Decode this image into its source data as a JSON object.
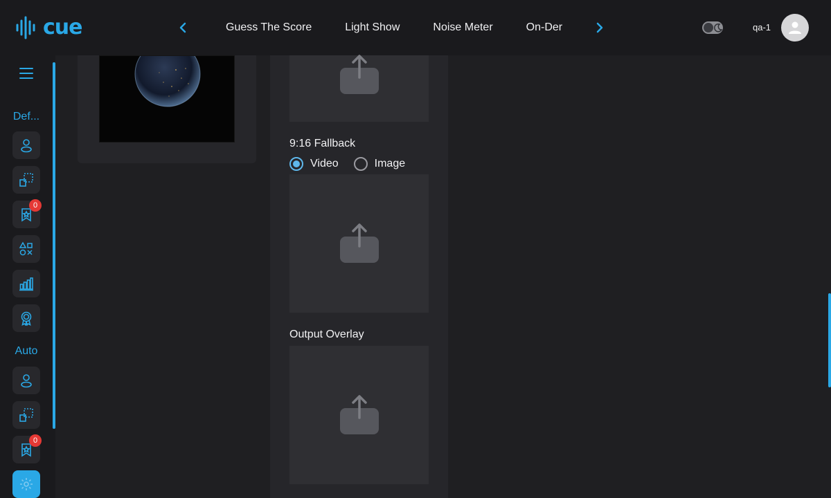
{
  "app": {
    "logo_text": "cue"
  },
  "header": {
    "tabs": [
      {
        "label": "Guess The Score"
      },
      {
        "label": "Light Show"
      },
      {
        "label": "Noise Meter"
      },
      {
        "label": "On-Der"
      }
    ],
    "username": "qa-1"
  },
  "sidebar": {
    "groups": [
      {
        "label": "Def...",
        "items": [
          {
            "icon": "person-icon"
          },
          {
            "icon": "transform-icon"
          },
          {
            "icon": "reward-icon",
            "badge": "0"
          },
          {
            "icon": "shapes-icon"
          },
          {
            "icon": "bar-chart-icon"
          },
          {
            "icon": "award-icon"
          }
        ]
      },
      {
        "label": "Auto",
        "items": [
          {
            "icon": "person-icon"
          },
          {
            "icon": "transform-icon"
          },
          {
            "icon": "reward-icon",
            "badge": "0"
          },
          {
            "icon": "settings-icon",
            "active": true
          }
        ]
      }
    ]
  },
  "main": {
    "fallback_section": {
      "title": "9:16 Fallback",
      "options": [
        {
          "label": "Video",
          "checked": true
        },
        {
          "label": "Image",
          "checked": false
        }
      ]
    },
    "overlay_section": {
      "title": "Output Overlay"
    }
  },
  "colors": {
    "accent": "#2aa8e6",
    "background": "#1f1f22",
    "panel": "#26262a",
    "badge": "#e53935"
  }
}
